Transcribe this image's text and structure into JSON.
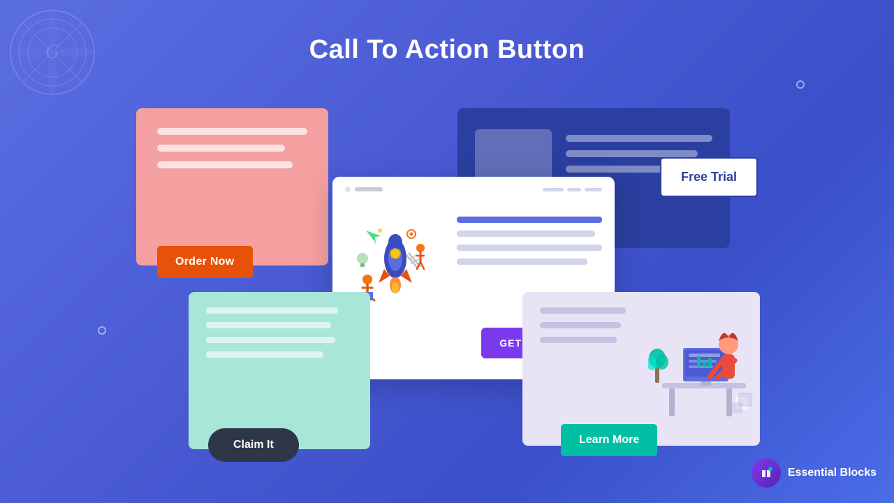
{
  "page": {
    "title": "Call To Action Button",
    "background_gradient_start": "#5b6ee1",
    "background_gradient_end": "#4a6de8"
  },
  "buttons": {
    "order_now": "Order Now",
    "free_trial": "Free Trial",
    "get_started": "GET STARTED",
    "claim_it": "Claim It",
    "learn_more": "Learn More"
  },
  "branding": {
    "name": "Essential Blocks",
    "icon_char": "ℰ"
  },
  "decorative": {
    "dot1": "circle",
    "dot2": "circle"
  }
}
